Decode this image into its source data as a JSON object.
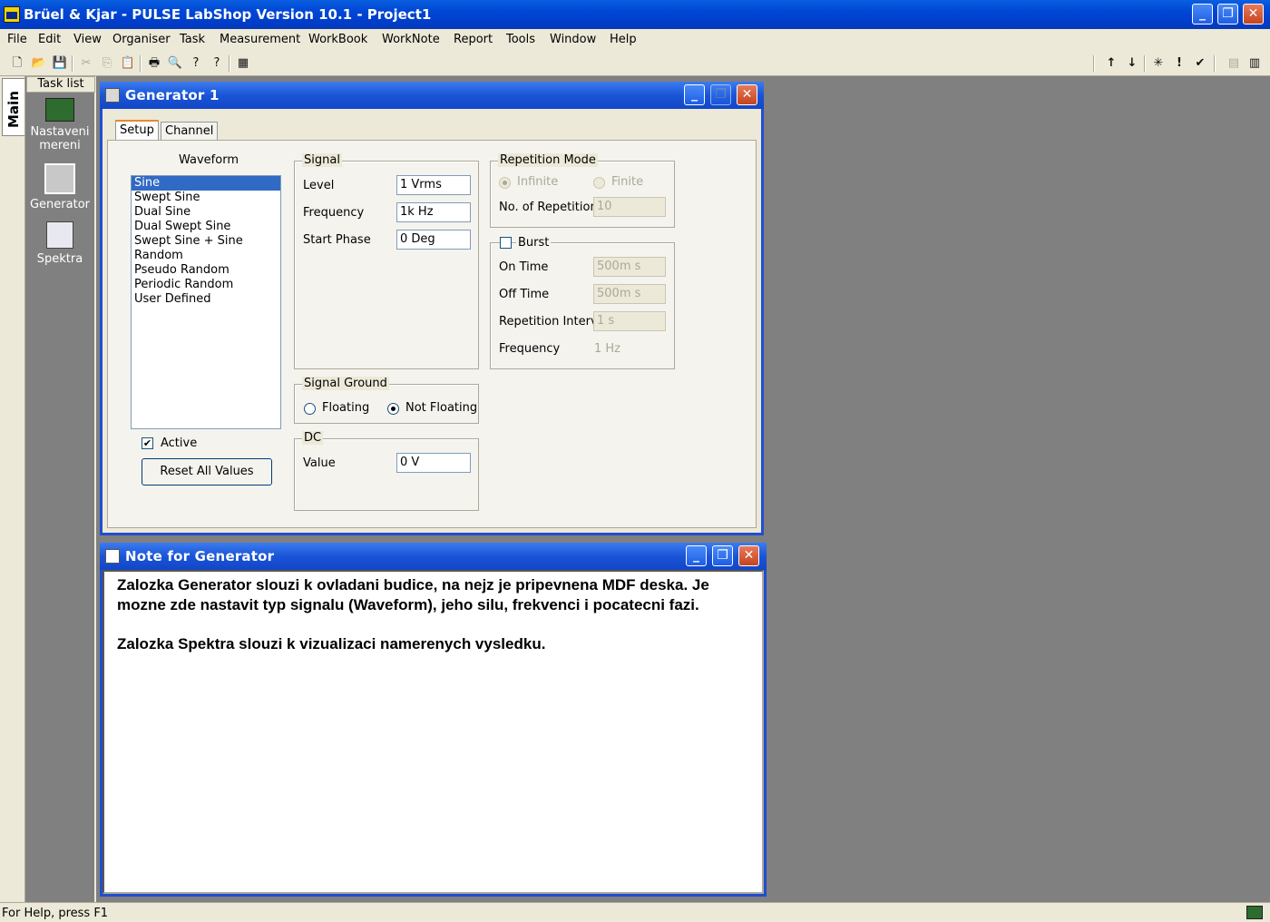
{
  "window": {
    "title": "Brüel & Kjar - PULSE LabShop Version 10.1 - Project1",
    "min": "_",
    "max": "❐",
    "close": "✕"
  },
  "menu": [
    "File",
    "Edit",
    "View",
    "Organiser",
    "Task",
    "Measurement",
    "WorkBook",
    "WorkNote",
    "Report",
    "Tools",
    "Window",
    "Help"
  ],
  "toolbar": {
    "left": [
      "🗋",
      "📂",
      "💾",
      "✂",
      "⎘",
      "📋",
      "🖶",
      "🔍",
      "?",
      "?",
      "▦"
    ],
    "right": [
      "↑",
      "↓",
      "✳",
      "!",
      "✔",
      "▤",
      "▥"
    ]
  },
  "rail": {
    "tab": "Main"
  },
  "tasklist": {
    "header": "Task list",
    "items": [
      {
        "label": "Nastaveni mereni",
        "icon": "network-card-icon"
      },
      {
        "label": "Generator",
        "icon": "generator-icon"
      },
      {
        "label": "Spektra",
        "icon": "spectrum-icon"
      }
    ]
  },
  "generator": {
    "title": "Generator 1",
    "tabs": [
      "Setup",
      "Channel"
    ],
    "waveform": {
      "label": "Waveform",
      "items": [
        "Sine",
        "Swept Sine",
        "Dual Sine",
        "Dual Swept Sine",
        "Swept Sine + Sine",
        "Random",
        "Pseudo Random",
        "Periodic Random",
        "User Defined"
      ],
      "selected": "Sine"
    },
    "active_label": "Active",
    "active_check": "✔",
    "reset_label": "Reset All Values",
    "signal": {
      "label": "Signal",
      "level_label": "Level",
      "level_value": "1 Vrms",
      "freq_label": "Frequency",
      "freq_value": "1k Hz",
      "phase_label": "Start Phase",
      "phase_value": "0 Deg"
    },
    "ground": {
      "label": "Signal Ground",
      "floating": "Floating",
      "not_floating": "Not Floating",
      "selected": "Not Floating"
    },
    "dc": {
      "label": "DC",
      "value_label": "Value",
      "value": "0 V"
    },
    "repetition": {
      "label": "Repetition Mode",
      "infinite": "Infinite",
      "finite": "Finite",
      "count_label": "No. of Repetitions",
      "count": "10"
    },
    "burst": {
      "label": "Burst",
      "on_label": "On Time",
      "on_value": "500m s",
      "off_label": "Off Time",
      "off_value": "500m s",
      "interval_label": "Repetition Interval",
      "interval_value": "1 s",
      "freq_label": "Frequency",
      "freq_value": "1 Hz"
    }
  },
  "note": {
    "title": "Note for Generator",
    "para1": "Zalozka Generator slouzi k ovladani budice, na nejz je pripevnena MDF deska. Je mozne zde nastavit typ signalu (Waveform), jeho silu, frekvenci i pocatecni fazi.",
    "para2": "Zalozka Spektra slouzi k vizualizaci namerenych vysledku."
  },
  "status": "For Help, press F1"
}
